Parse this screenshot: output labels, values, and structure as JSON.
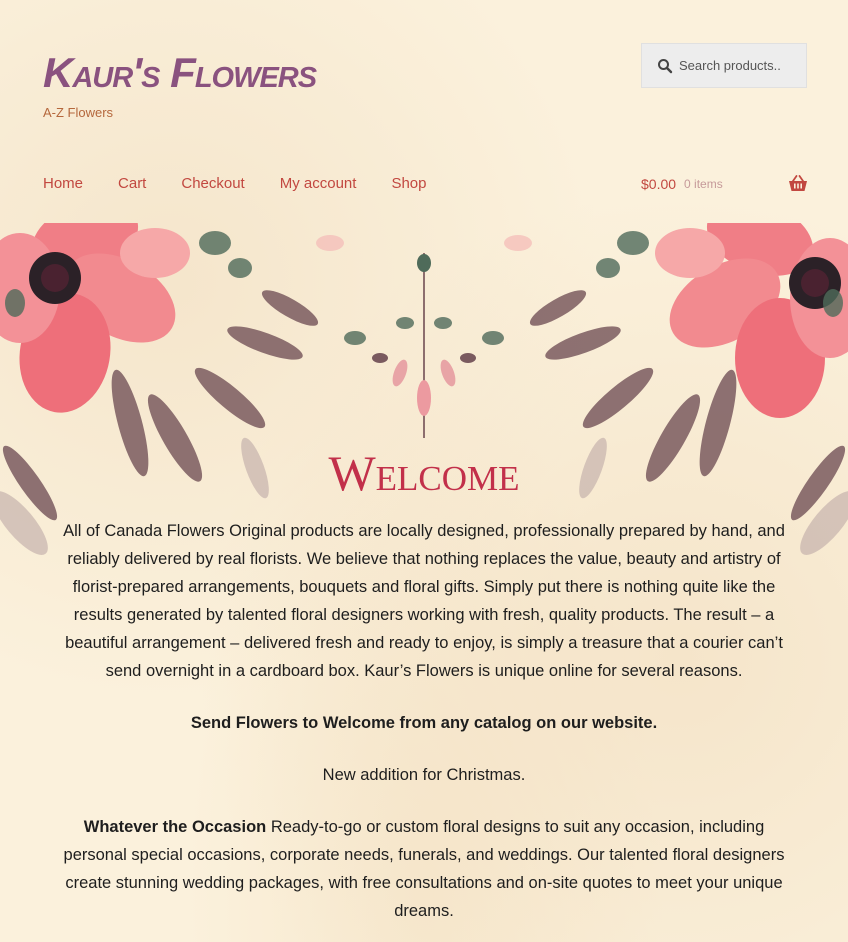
{
  "site": {
    "title": "Kaur's Flowers",
    "tagline": "A-Z Flowers"
  },
  "search": {
    "placeholder": "Search products..",
    "icon": "search-icon"
  },
  "nav": {
    "items": [
      {
        "label": "Home"
      },
      {
        "label": "Cart"
      },
      {
        "label": "Checkout"
      },
      {
        "label": "My account"
      },
      {
        "label": "Shop"
      }
    ]
  },
  "cart": {
    "amount": "$0.00",
    "count": "0 items",
    "icon": "basket-icon"
  },
  "main": {
    "heading": "Welcome",
    "intro": "All of Canada Flowers Original products are locally designed, professionally prepared by hand, and reliably delivered by real florists. We believe that nothing replaces the value, beauty and artistry of florist-prepared arrangements, bouquets and floral gifts. Simply put there is nothing quite like the results generated by talented floral designers working with fresh, quality products. The result – a beautiful arrangement – delivered fresh and ready to enjoy, is simply a treasure that a courier can’t send overnight in a cardboard box. Kaur’s Flowers is unique online for several reasons.",
    "send_line": "Send Flowers to Welcome from any catalog on our website.",
    "christmas": "New addition for Christmas.",
    "occasion_lead": "Whatever the Occasion",
    "occasion_text": " Ready-to-go or custom floral designs to suit any occasion, including personal special occasions, corporate needs, funerals, and weddings. Our talented floral designers create stunning wedding packages, with free consultations and on-site quotes to meet your unique dreams."
  },
  "colors": {
    "title": "#8a527f",
    "nav_link": "#c24840",
    "heading": "#c2304a",
    "background": "#fbf1dc"
  }
}
